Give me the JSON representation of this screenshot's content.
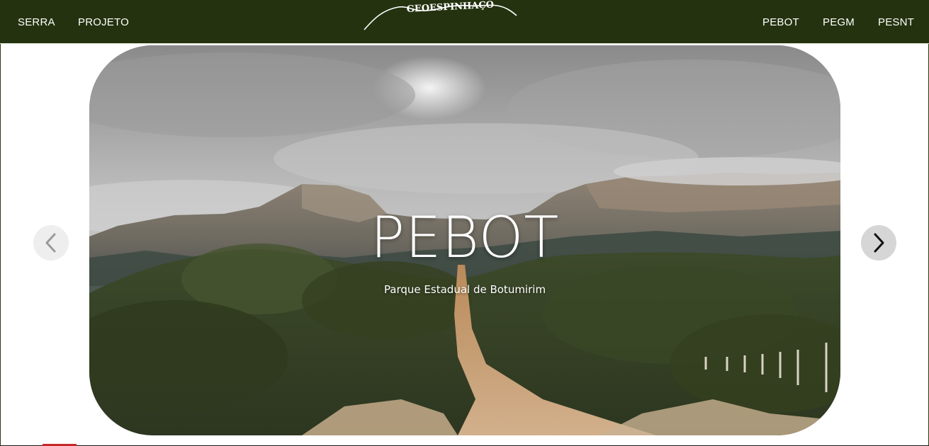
{
  "nav": {
    "left_links": [
      "SERRA",
      "PROJETO"
    ],
    "right_links": [
      "PEBOT",
      "PEGM",
      "PESNT"
    ],
    "logo_text": "GEOESPINHAÇO",
    "background_color": "#24320f"
  },
  "carousel": {
    "active_slide": {
      "title": "PEBOT",
      "subtitle": "Parque Estadual de Botumirim"
    },
    "prev_icon": "chevron-left-icon",
    "next_icon": "chevron-right-icon"
  }
}
